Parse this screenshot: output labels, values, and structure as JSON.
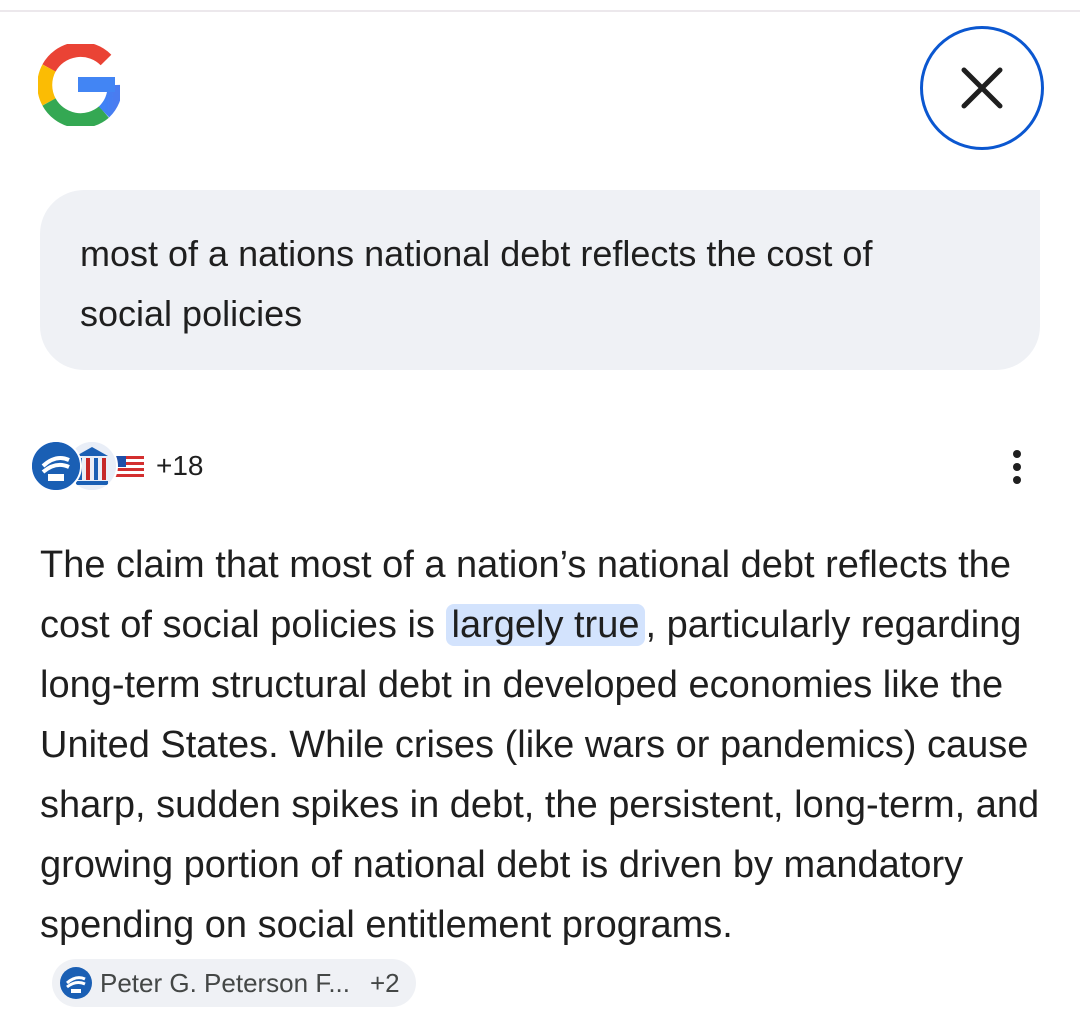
{
  "header": {
    "logo": "google-g-logo",
    "close_icon": "close-icon"
  },
  "query": {
    "text": "most of a nations national debt reflects the cost of social policies"
  },
  "sources": {
    "icons": [
      "peterson-foundation-icon",
      "government-building-icon",
      "us-flag-icon"
    ],
    "more_count": "+18",
    "menu_icon": "more-vert-icon"
  },
  "answer": {
    "part1": "The claim that most of a nation’s national debt reflects the cost of social policies is ",
    "highlight": "largely true",
    "part2": ", particularly regarding long-term structural debt in developed economies like the United States. While crises (like wars or pandemics) cause sharp, sudden spikes in debt, the persistent, long-term, and growing portion of national debt is driven by mandatory spending on social entitlement programs.",
    "citation": {
      "label": "Peter G. Peterson F...",
      "extra": "+2"
    }
  },
  "colors": {
    "accent_blue": "#0b57d0",
    "highlight_bg": "#d3e3fd",
    "bubble_bg": "#eff1f5"
  }
}
